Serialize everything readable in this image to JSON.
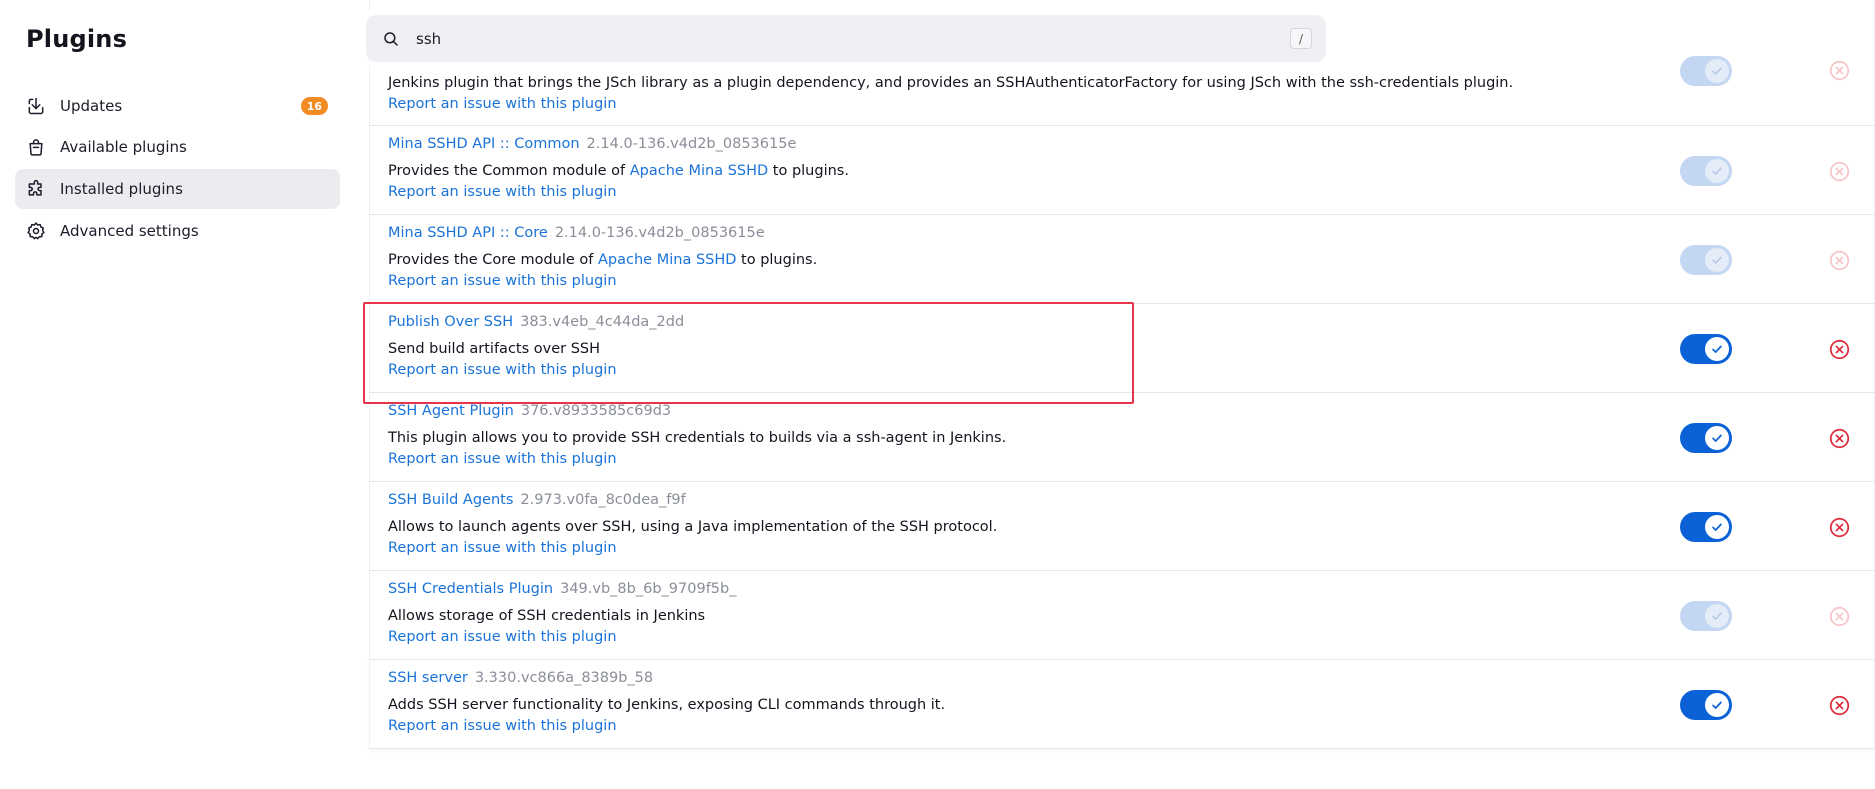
{
  "sidebar": {
    "title": "Plugins",
    "items": [
      {
        "label": "Updates",
        "badge": "16"
      },
      {
        "label": "Available plugins"
      },
      {
        "label": "Installed plugins"
      },
      {
        "label": "Advanced settings"
      }
    ]
  },
  "search": {
    "value": "ssh",
    "shortcut": "/"
  },
  "report_label": "Report an issue with this plugin",
  "colors": {
    "link": "#1a73d9",
    "toggle_on": "#0b62d6",
    "uninstall": "#e02a3a",
    "badge": "#f28b22",
    "highlight": "#e8344a"
  },
  "plugins": [
    {
      "name": "",
      "version": "",
      "description": "Jenkins plugin that brings the JSch library as a plugin dependency, and provides an SSHAuthenticatorFactory for using JSch with the ssh-credentials plugin.",
      "enabled": true,
      "toggle_editable": false,
      "uninstall_enabled": false
    },
    {
      "name": "Mina SSHD API :: Common",
      "version": "2.14.0-136.v4d2b_0853615e",
      "description_prefix": "Provides the Common module of ",
      "description_link": "Apache Mina SSHD",
      "description_suffix": " to plugins.",
      "enabled": true,
      "toggle_editable": false,
      "uninstall_enabled": false
    },
    {
      "name": "Mina SSHD API :: Core",
      "version": "2.14.0-136.v4d2b_0853615e",
      "description_prefix": "Provides the Core module of ",
      "description_link": "Apache Mina SSHD",
      "description_suffix": " to plugins.",
      "enabled": true,
      "toggle_editable": false,
      "uninstall_enabled": false
    },
    {
      "name": "Publish Over SSH",
      "version": "383.v4eb_4c44da_2dd",
      "description": "Send build artifacts over SSH",
      "enabled": true,
      "toggle_editable": true,
      "uninstall_enabled": true,
      "highlighted": true
    },
    {
      "name": "SSH Agent Plugin",
      "version": "376.v8933585c69d3",
      "description": "This plugin allows you to provide SSH credentials to builds via a ssh-agent in Jenkins.",
      "enabled": true,
      "toggle_editable": true,
      "uninstall_enabled": true
    },
    {
      "name": "SSH Build Agents",
      "version": "2.973.v0fa_8c0dea_f9f",
      "description": "Allows to launch agents over SSH, using a Java implementation of the SSH protocol.",
      "enabled": true,
      "toggle_editable": true,
      "uninstall_enabled": true
    },
    {
      "name": "SSH Credentials Plugin",
      "version": "349.vb_8b_6b_9709f5b_",
      "description": "Allows storage of SSH credentials in Jenkins",
      "enabled": true,
      "toggle_editable": false,
      "uninstall_enabled": false
    },
    {
      "name": "SSH server",
      "version": "3.330.vc866a_8389b_58",
      "description": "Adds SSH server functionality to Jenkins, exposing CLI commands through it.",
      "enabled": true,
      "toggle_editable": true,
      "uninstall_enabled": true
    }
  ]
}
